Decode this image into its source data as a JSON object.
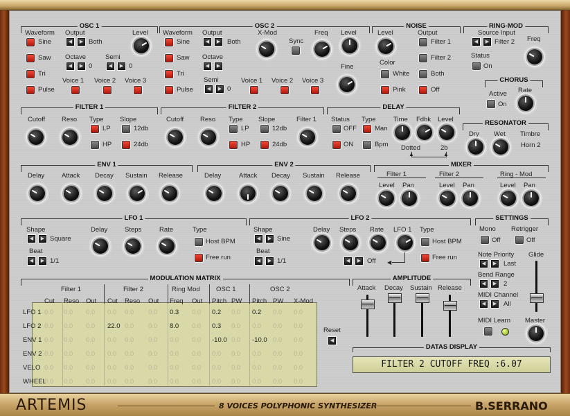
{
  "osc1": {
    "title": "OSC 1",
    "waveform": "Waveform",
    "output": "Output",
    "level": "Level",
    "sine": "Sine",
    "saw": "Saw",
    "tri": "Tri",
    "pulse": "Pulse",
    "both": "Both",
    "octave": "Octave",
    "oct_val": "0",
    "semi": "Semi",
    "semi_val": "0",
    "voice1": "Voice 1",
    "voice2": "Voice 2",
    "voice3": "Voice 3"
  },
  "osc2": {
    "title": "OSC 2",
    "waveform": "Waveform",
    "output": "Output",
    "xmod": "X-Mod",
    "sync": "Sync",
    "freq": "Freq",
    "level": "Level",
    "sine": "Sine",
    "saw": "Saw",
    "tri": "Tri",
    "pulse": "Pulse",
    "both": "Both",
    "octave": "Octave",
    "semi": "Semi",
    "semi_val": "0",
    "voice1": "Voice 1",
    "voice2": "Voice 2",
    "voice3": "Voice 3",
    "fine": "Fine"
  },
  "noise": {
    "title": "NOISE",
    "level": "Level",
    "output": "Output",
    "filter1": "Filter 1",
    "filter2": "Filter 2",
    "both": "Both",
    "off": "Off",
    "color": "Color",
    "white": "White",
    "pink": "Pink"
  },
  "ringmod": {
    "title": "RING-MOD",
    "source_input": "Source Input",
    "source_val": "Filter 2",
    "freq": "Freq",
    "status": "Status",
    "status_val": "On"
  },
  "chorus": {
    "title": "CHORUS",
    "active": "Active",
    "active_val": "On",
    "rate": "Rate"
  },
  "filter1": {
    "title": "FILTER 1",
    "cutoff": "Cutoff",
    "reso": "Reso",
    "type": "Type",
    "slope": "Slope",
    "lp": "LP",
    "hp": "HP",
    "db12": "12db",
    "db24": "24db"
  },
  "filter2": {
    "title": "FILTER 2",
    "cutoff": "Cutoff",
    "reso": "Reso",
    "type": "Type",
    "slope": "Slope",
    "lp": "LP",
    "hp": "HP",
    "db12": "12db",
    "db24": "24db",
    "filter1": "Filter 1"
  },
  "delay": {
    "title": "DELAY",
    "status": "Status",
    "off": "OFF",
    "on": "ON",
    "type": "Type",
    "man": "Man",
    "bpm": "Bpm",
    "time": "Time",
    "fdbk": "Fdbk",
    "level": "Level",
    "dotted": "Dotted",
    "val2b": "2b"
  },
  "resonator": {
    "title": "RESONATOR",
    "dry": "Dry",
    "wet": "Wet",
    "timbre": "Timbre",
    "timbre_val": "Horn 2"
  },
  "env1": {
    "title": "ENV 1",
    "delay": "Delay",
    "attack": "Attack",
    "decay": "Decay",
    "sustain": "Sustain",
    "release": "Release"
  },
  "env2": {
    "title": "ENV 2",
    "delay": "Delay",
    "attack": "Attack",
    "decay": "Decay",
    "sustain": "Sustain",
    "release": "Release"
  },
  "mixer": {
    "title": "MIXER",
    "filter1": "Filter 1",
    "filter2": "Filter 2",
    "ringmod": "Ring - Mod",
    "level": "Level",
    "pan": "Pan"
  },
  "lfo1": {
    "title": "LFO 1",
    "shape": "Shape",
    "shape_val": "Square",
    "beat": "Beat",
    "beat_val": "1/1",
    "delay": "Delay",
    "steps": "Steps",
    "rate": "Rate",
    "type": "Type",
    "host": "Host BPM",
    "free": "Free run"
  },
  "lfo2": {
    "title": "LFO 2",
    "shape": "Shape",
    "shape_val": "Sine",
    "beat": "Beat",
    "beat_val": "1/1",
    "delay": "Delay",
    "steps": "Steps",
    "rate": "Rate",
    "lfo1": "LFO 1",
    "type": "Type",
    "host": "Host BPM",
    "free": "Free run",
    "off": "Off"
  },
  "settings": {
    "title": "SETTINGS",
    "mono": "Mono",
    "mono_val": "Off",
    "retrigger": "Retrigger",
    "retrigger_val": "Off",
    "note_priority": "Note Priority",
    "note_val": "Last",
    "bend": "Bend Range",
    "bend_val": "2",
    "midi_channel": "MIDI Channel",
    "midi_val": "All",
    "midi_learn": "MIDI Learn",
    "glide": "Glide",
    "master": "Master"
  },
  "amplitude": {
    "title": "AMPLITUDE",
    "attack": "Attack",
    "decay": "Decay",
    "sustain": "Sustain",
    "release": "Release"
  },
  "matrix": {
    "title": "MODULATION MATRIX",
    "groups": [
      "Filter 1",
      "Filter 2",
      "Ring Mod",
      "OSC 1",
      "OSC 2"
    ],
    "cols": [
      "Cut",
      "Reso",
      "Out",
      "Cut",
      "Reso",
      "Out",
      "Freq",
      "Out",
      "Pitch",
      "PW",
      "Pitch",
      "PW",
      "X-Mod"
    ],
    "rows": [
      {
        "name": "LFO 1",
        "cells": [
          "0.0",
          "0.0",
          "0.0",
          "0.0",
          "0.0",
          "0.0",
          "0.3",
          "0.0",
          "0.2",
          "0.0",
          "0.2",
          "0.0",
          "0.0"
        ]
      },
      {
        "name": "LFO 2",
        "cells": [
          "0.0",
          "0.0",
          "0.0",
          "22.0",
          "0.0",
          "0.0",
          "8.0",
          "0.0",
          "0.3",
          "0.0",
          "0.0",
          "0.0",
          "0.0"
        ]
      },
      {
        "name": "ENV 1",
        "cells": [
          "0.0",
          "0.0",
          "0.0",
          "0.0",
          "0.0",
          "0.0",
          "0.0",
          "0.0",
          "-10.0",
          "0.0",
          "-10.0",
          "0.0",
          "0.0"
        ]
      },
      {
        "name": "ENV 2",
        "cells": [
          "0.0",
          "0.0",
          "0.0",
          "0.0",
          "0.0",
          "0.0",
          "0.0",
          "0.0",
          "0.0",
          "0.0",
          "0.0",
          "0.0",
          "0.0"
        ]
      },
      {
        "name": "VELO",
        "cells": [
          "0.0",
          "0.0",
          "0.0",
          "0.0",
          "0.0",
          "0.0",
          "0.0",
          "0.0",
          "0.0",
          "0.0",
          "0.0",
          "0.0",
          "0.0"
        ]
      },
      {
        "name": "WHEEL",
        "cells": [
          "0.0",
          "0.0",
          "0.0",
          "0.0",
          "0.0",
          "0.0",
          "0.0",
          "0.0",
          "0.0",
          "0.0",
          "0.0",
          "0.0",
          "0.0"
        ]
      }
    ],
    "reset": "Reset"
  },
  "datas": {
    "title": "DATAS DISPLAY",
    "text": "FILTER 2 CUTOFF FREQ :6.07"
  },
  "footer": {
    "logo": "ARTEMIS",
    "subtitle": "8 VOICES POLYPHONIC SYNTHESIZER",
    "author": "B.SERRANO"
  }
}
